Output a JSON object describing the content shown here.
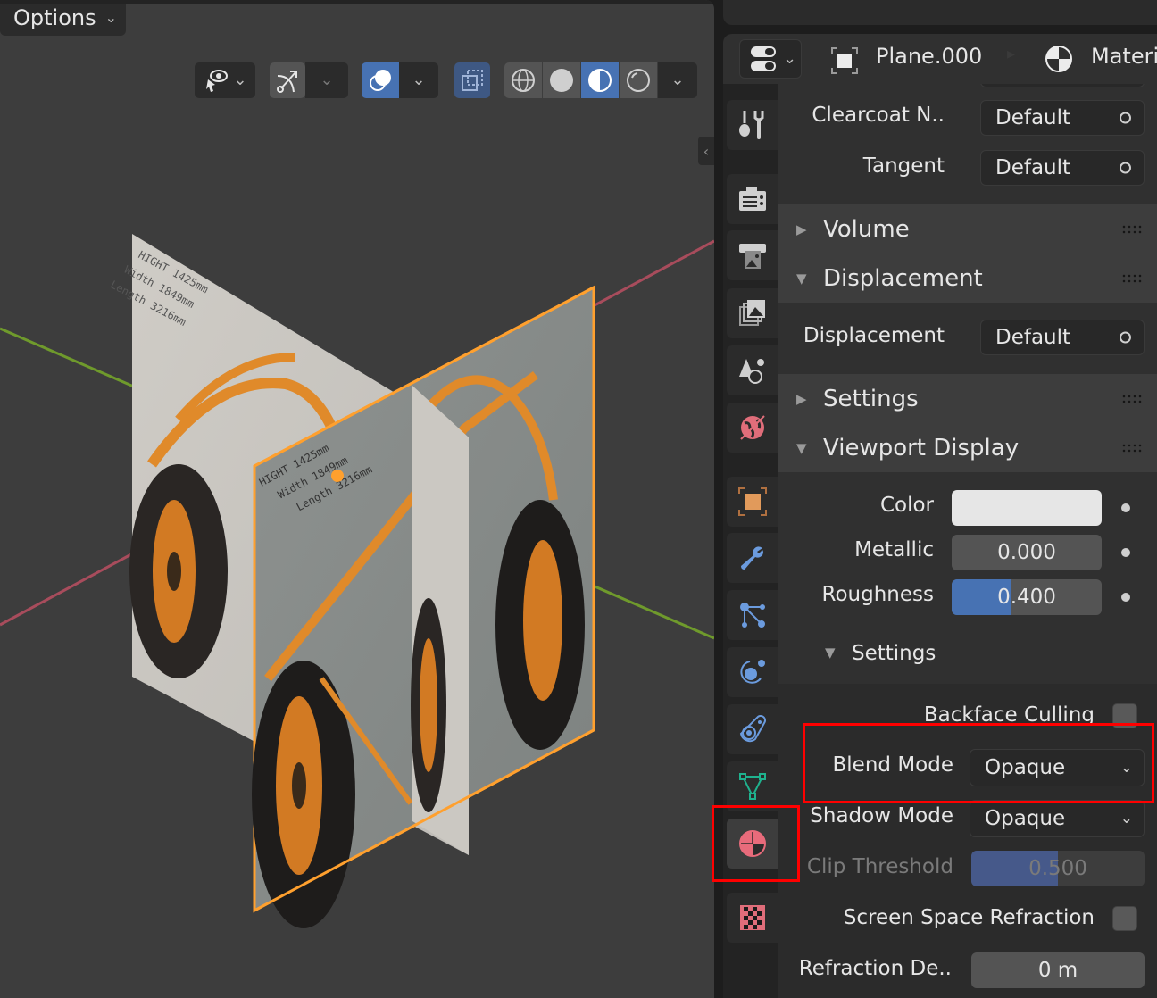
{
  "viewport": {
    "options_label": "Options",
    "header_tools": [
      {
        "name": "selectability-visibility",
        "icon": "eye-cursor-icon",
        "state": "normal"
      },
      {
        "name": "gizmo-toggle",
        "icon": "gizmo-icon",
        "state": "lite"
      },
      {
        "name": "overlays-toggle",
        "icon": "overlays-icon",
        "state": "active"
      },
      {
        "name": "xray-toggle",
        "icon": "xray-icon",
        "state": "on"
      },
      {
        "name": "shading-wireframe",
        "icon": "wireframe-sphere-icon",
        "state": "lite"
      },
      {
        "name": "shading-solid",
        "icon": "solid-sphere-icon",
        "state": "lite"
      },
      {
        "name": "shading-material-preview",
        "icon": "material-preview-icon",
        "state": "active"
      },
      {
        "name": "shading-rendered",
        "icon": "rendered-sphere-icon",
        "state": "lite"
      }
    ],
    "scene": {
      "plane_text_lines": [
        "HIGHT 1425mm",
        "Width 1849mm",
        "Length 3216mm"
      ],
      "axis_colors": {
        "x": "#a84c5c",
        "y": "#6f9a2c"
      },
      "selection_color": "#ffa02e",
      "origin_dot_color": "#ffa02e"
    }
  },
  "properties": {
    "breadcrumb": {
      "object_name": "Plane.000",
      "material_name": "Materi"
    },
    "tabs": [
      {
        "name": "tool",
        "icon": "tool-icon",
        "color": "#cfcfcf",
        "active": false
      },
      {
        "name": "render",
        "icon": "render-camera-icon",
        "color": "#cfcfcf",
        "active": false
      },
      {
        "name": "output",
        "icon": "output-printer-icon",
        "color": "#cfcfcf",
        "active": false
      },
      {
        "name": "view-layer",
        "icon": "view-layer-icon",
        "color": "#cfcfcf",
        "active": false
      },
      {
        "name": "scene",
        "icon": "scene-icon",
        "color": "#cfcfcf",
        "active": false
      },
      {
        "name": "world",
        "icon": "world-icon",
        "color": "#e06d7a",
        "active": false
      },
      {
        "name": "object",
        "icon": "object-icon",
        "color": "#e19a5b",
        "active": false
      },
      {
        "name": "modifiers",
        "icon": "wrench-icon",
        "color": "#6b9bde",
        "active": false
      },
      {
        "name": "particles",
        "icon": "particles-icon",
        "color": "#6b9bde",
        "active": false
      },
      {
        "name": "physics",
        "icon": "physics-icon",
        "color": "#6b9bde",
        "active": false
      },
      {
        "name": "constraints",
        "icon": "constraints-icon",
        "color": "#6b9bde",
        "active": false
      },
      {
        "name": "data",
        "icon": "mesh-data-icon",
        "color": "#1fb28e",
        "active": false
      },
      {
        "name": "material",
        "icon": "material-icon",
        "color": "#e86b7b",
        "active": true
      },
      {
        "name": "texture",
        "icon": "texture-checker-icon",
        "color": "#e06d7a",
        "active": false
      }
    ],
    "fields": {
      "clearcoat_normal": {
        "label": "Clearcoat N..",
        "value": "Default"
      },
      "tangent": {
        "label": "Tangent",
        "value": "Default"
      },
      "displacement": {
        "label": "Displacement",
        "value": "Default"
      }
    },
    "panels": {
      "volume": {
        "title": "Volume",
        "expanded": false
      },
      "displacement": {
        "title": "Displacement",
        "expanded": true
      },
      "settings": {
        "title": "Settings",
        "expanded": false
      },
      "viewport_display": {
        "title": "Viewport Display",
        "expanded": true
      }
    },
    "viewport_display": {
      "color_label": "Color",
      "color_value": "#e6e6e6",
      "metallic_label": "Metallic",
      "metallic_value": "0.000",
      "metallic_fraction": 0.0,
      "roughness_label": "Roughness",
      "roughness_value": "0.400",
      "roughness_fraction": 0.4,
      "settings_title": "Settings",
      "settings_expanded": true
    },
    "settings": {
      "backface_culling_label": "Backface Culling",
      "backface_culling_checked": false,
      "blend_mode_label": "Blend Mode",
      "blend_mode_value": "Opaque",
      "shadow_mode_label": "Shadow Mode",
      "shadow_mode_value": "Opaque",
      "clip_threshold_label": "Clip Threshold",
      "clip_threshold_value": "0.500",
      "clip_threshold_fraction": 0.5,
      "ssr_label": "Screen Space Refraction",
      "ssr_checked": false,
      "refraction_depth_label": "Refraction De..",
      "refraction_depth_value": "0 m"
    }
  },
  "annotations": {
    "highlight_color": "#ff0000",
    "boxes": [
      "blend-mode-row",
      "material-tab"
    ]
  }
}
